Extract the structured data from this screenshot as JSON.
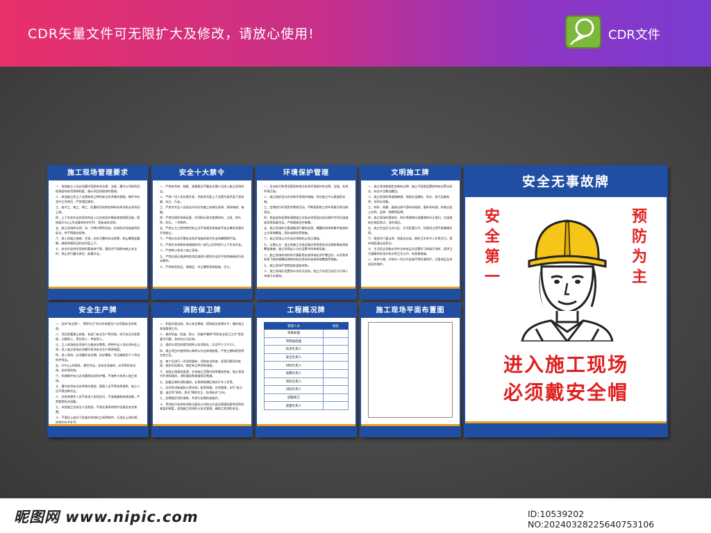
{
  "banner": {
    "text": "CDR矢量文件可无限扩大及修改，请放心使用!",
    "badge_label": "CDR文件",
    "logo_icon": "coreldraw-logo-icon",
    "colors": {
      "left": "#e8306a",
      "right": "#7a3cd0"
    }
  },
  "boards": [
    {
      "title": "施工现场管理要求",
      "paragraphs": [
        "一、现场施工人员必须遵守国家有关法律、法规，遵守公司和项目经理部的各项规章制度，服从项目经理部的管理。",
        "二、参加施工的工人应熟知本工种的安全技术操作规程。操作中应坚守工作岗位，严禁酒后操作。",
        "三、架子工、电工、焊工、起重机司机和各种机动车司机必须持证上岗。",
        "四、上下交叉作业有危险的出入口应有防护棚或其他隔离设施，距地面2m以上作业要有防护栏杆、挡板或安全网。",
        "五、施工现场的坑洞、沟、升降口等危险处，应有防护设施或明显标志，并不得擅自拆移。",
        "六、乘人的施工电梯、吊笼，应有可靠的安全装置，禁止攀登起重臂，绳索和随同运料的吊篮上下。",
        "七、安全作业时所用材料要堆放平稳，遇恶劣气候影响施工安全时，禁止进行露天高空、起重作业。"
      ]
    },
    {
      "title": "安全十大禁令",
      "paragraphs": [
        "一、严禁穿木底、拖鞋、高跟鞋及不戴安全帽人员进入施工现场作业。",
        "二、严禁一切人员在提升架、吊机的吊篮上下及提升架吊篮下面穿越、站立、行走。",
        "三、严禁非专业人员私自开动任何施工机械及驳接、拆除电线、电器。",
        "四、严禁在操作现场玩耍、吵闹和从高空抛掷材料、工具、砖头等，砂石、一切物件。",
        "五、严禁土方工程的掏空取土及不按规定放坡或不加支撑的深基坑开挖施工。",
        "六、严禁在未设可靠安全防护设施的高空作业和攀爬脚手架。",
        "七、严禁在未采取有效措施的同一部位上同时进行上下交叉作业。",
        "八、严禁带小孩进入施工现场。",
        "九、严禁在高压电源的危险区域进行冒险作业及不穿绝缘鞋进行机动操作。",
        "十、严禁有危险品、易燃品、木工棚等现场吸烟、生火。"
      ]
    },
    {
      "title": "环境保护管理",
      "paragraphs": [
        "一、坚决执行和贯彻国家和地方有关环境保护的法律、法规，杜绝环境污染。",
        "二、施工组织设计必须有环境保护措施，并在施工中认真组织实施。",
        "三、定期进行环保宣传教育活动，不断提高职工的环保意识和法制观念。",
        "四、底层或多层建筑清理施工垃圾必须搭设封闭式临时专用垃圾道或采用容器吊运，严禁随意凌空抛撒。",
        "五、施工现场的主要道路进行硬化处理，裸露的场地和集中堆放的土方采取覆盖、固化或绿化等措施。",
        "六、施工现场土方作业应采取防止扬尘措施。",
        "七、从事土方、渣土和施工垃圾运输应采用密闭式运输车辆或采取覆盖措施；施工现场出入口应设置冲洗车辆设施。",
        "八、施工现场的材料和大模板等存放场地必须平整坚实，水泥和其他易飞扬的细颗粒建筑材料应密闭存放或采取覆盖等措施。",
        "九、施工现场严禁焚烧各类废弃物。",
        "十、施工现场应设置排水沟及沉淀池，施工污水经沉淀后方可排入市政污水管网。"
      ]
    },
    {
      "title": "文明施工牌",
      "paragraphs": [
        "一、施工现场按规定安装标志牌，施工平面图设置各种安全警示标志，标志齐全整洁醒目。",
        "二、施工现场四周道路畅通，地面应当硬化、排水、排污设施有序，无积水现象。",
        "三、材料、构建、器具应按平面布局堆放，要有条有理，料堆应挂上名称、品种、规格等标牌。",
        "四、施工现场的落地灰、砖头等建筑垃圾要做到天天清扫，垃圾堆放在指定地点，及时清运。",
        "五、施工作业区与办公区、生活区要分开，住建设工程不能兼做住宿。",
        "六、宿舍内门窗洁净，地面无垃圾，厕所卫生有专人负责打扫，保持地面清洁无积水。",
        "七、生活区应设能必须齐全有效且应设置学习和娱乐场所，提供卫生健康的饮用水有文明卫生公约，有急救措施。",
        "八、紧护公物，对场内一切公共设施不得任意损坏，注意成品及半成品的保护。"
      ]
    },
    {
      "title": "安全生产牌",
      "paragraphs": [
        "一、坚持\"安全第一、预防为主\"的方针和管生产必须管安全的原则。",
        "二、项目部要建立各级、各部门安全生产责任制，实行安全目标管理，分解到人，责任到人，考核到人。",
        "三、工人进场前必须进行三级安全教育，特种作业人员必须持证上岗，进入施工现场必须遵守各项安全生产规章制度。",
        "四、进入现场，必须戴好安全帽，扣好帽带，并正确使用个人劳动防护用品。",
        "五、2m以上的高处、悬空作业，无安全设施的，必须系好安全带，扣好保险钩。",
        "六、机械操作有工必须遵规定安防护帽，不准带小孩进入施工现场。",
        "七、遵守各项安全技术操作规程，管理人员不得违章指挥，施工人员不得违章作业。",
        "八、非有关操作人员不准进入危险区内，不准电器和机械设备，严禁使用机动设备。",
        "九、未经施工员安全人员批准，不准任意拆除防护设施及安全装置。",
        "十、不准往上或向下乱抛任何材料工具等物件，凡违反上述纪律，按规定给予处罚。"
      ]
    },
    {
      "title": "消防保卫牌",
      "paragraphs": [
        "一、积极开展法制、防火安全教育，提高政治思想水平，做好施工现场管理工作。",
        "二、做好防盗、防盗、防火、防破坏事故\"四防安全保卫工作\"发现重大问题，及时向公司反映。",
        "三、组织以项目经理为首的义务消防队，队员不少于3-5人。",
        "四、建立项目内使用明火和明火作业审批制度，严禁工棚和宿舍等在施工区。",
        "五、每个月进行一次消防器材、消防安全检查，发现问题及时处理，组织实际情况，制定有工种消防措施。",
        "六、加强工地值班巡逻，在本施工范围内经常督促检查，施工现场内外消防器材，消防器具和通道保证畅通。",
        "七、配备足够的消防器材，在易燃易爆区域实行专人负责。",
        "八、及时宣讲各级防火责任制，职责明确，共同管理，实行\"谁主管、谁负责\"原则，责任\"预防为主、防消结合\"方针。",
        "九、定期组织消防演练，并进行定期检查维护。",
        "十、贯彻执行有关的消防法规及公司的火灾安全管理制度和消防检查监护制度，加强施工现场防火安全管理，确保工程消防安全。"
      ]
    },
    {
      "title": "工程概况牌",
      "table": {
        "header": [
          "管理人员",
          "姓名"
        ],
        "rows": [
          "项目经理",
          "项目副经理",
          "技术负责人",
          "安全负责人",
          "材料负责人",
          "核算负责人",
          "资料负责人",
          "试验负责人",
          "后勤保卫",
          "质量负责人"
        ]
      }
    },
    {
      "title": "施工现场平面布置图"
    }
  ],
  "big_board": {
    "title": "安全无事故牌",
    "left_vertical": "安全第一",
    "right_vertical": "预防为主",
    "illustration_icon": "worker-with-hardhat-icon",
    "slogan_line1": "进入施工现场",
    "slogan_line2": "必须戴安全帽",
    "colors": {
      "blue": "#1f4ea3",
      "red": "#e02020",
      "hardhat": "#f5c518"
    }
  },
  "footer": {
    "brand": "昵图网 www.nipic.com",
    "id_text": "ID:10539202 NO:20240328225640753106"
  }
}
